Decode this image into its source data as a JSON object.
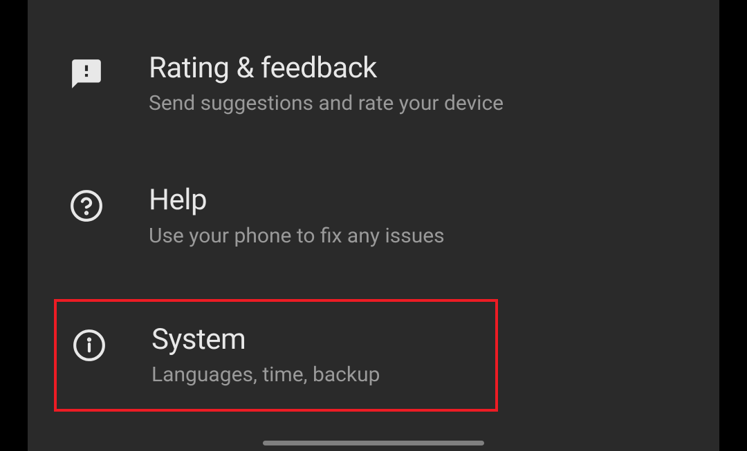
{
  "settings": {
    "items": [
      {
        "title": "Rating & feedback",
        "subtitle": "Send suggestions and rate your device"
      },
      {
        "title": "Help",
        "subtitle": "Use your phone to fix any issues"
      },
      {
        "title": "System",
        "subtitle": "Languages, time, backup"
      }
    ]
  },
  "colors": {
    "highlight": "#ed1c24",
    "background": "#2a2a2a",
    "titleText": "#e8e8e8",
    "subtitleText": "#9a9a9a"
  }
}
